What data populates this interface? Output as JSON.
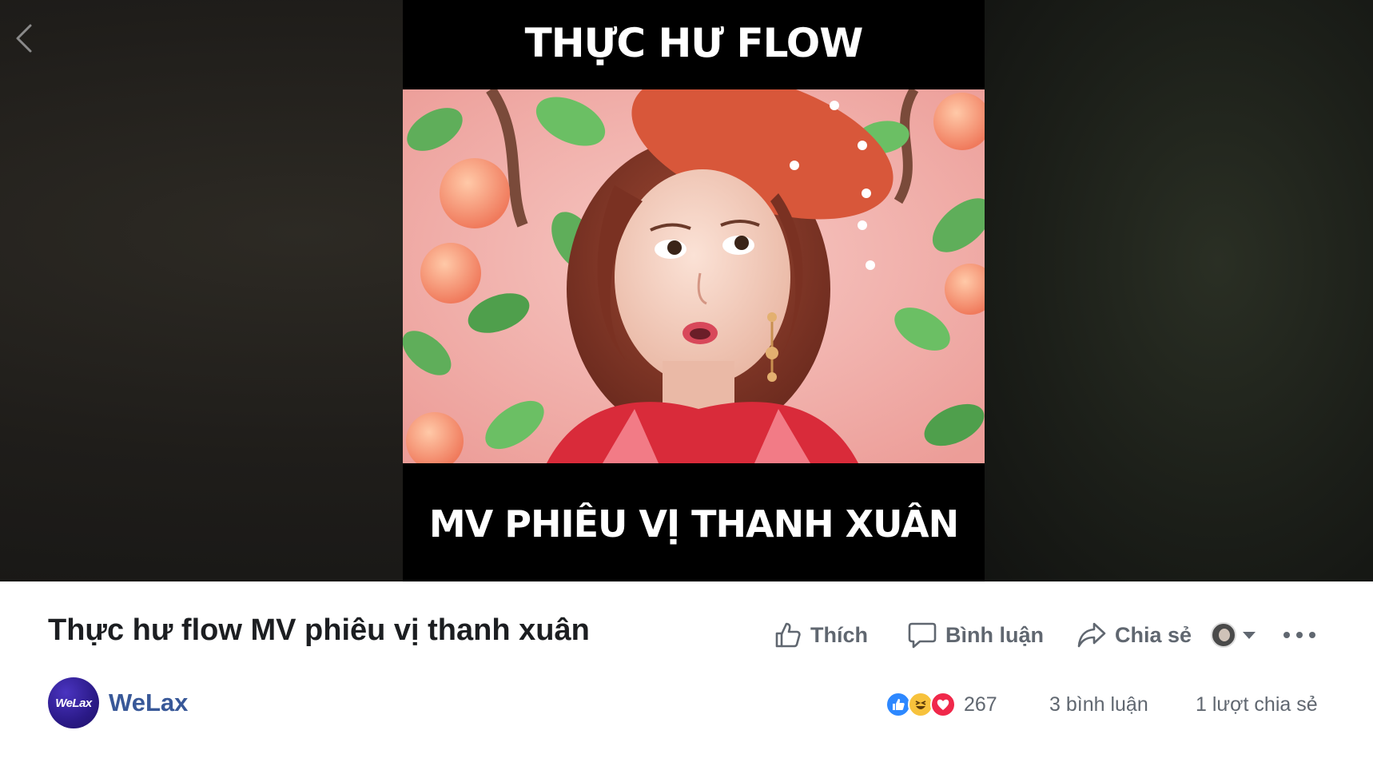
{
  "video": {
    "top_caption": "THỰC HƯ FLOW",
    "bottom_caption": "MV PHIÊU VỊ THANH XUÂN"
  },
  "post": {
    "title": "Thực hư flow MV phiêu vị thanh xuân"
  },
  "actions": {
    "like_label": "Thích",
    "comment_label": "Bình luận",
    "share_label": "Chia sẻ"
  },
  "page": {
    "avatar_text": "WeLax",
    "name": "WeLax"
  },
  "stats": {
    "reaction_count": "267",
    "comments": "3 bình luận",
    "shares": "1 lượt chia sẻ"
  },
  "colors": {
    "link_blue": "#385898",
    "muted_gray": "#606770",
    "like_blue": "#2d88ff",
    "love_red": "#f0284a",
    "haha_yellow": "#f7c23c"
  },
  "icons": [
    "back-arrow-icon",
    "thumbs-up-icon",
    "comment-bubble-icon",
    "share-arrow-icon",
    "chevron-down-icon",
    "more-dots-icon"
  ]
}
